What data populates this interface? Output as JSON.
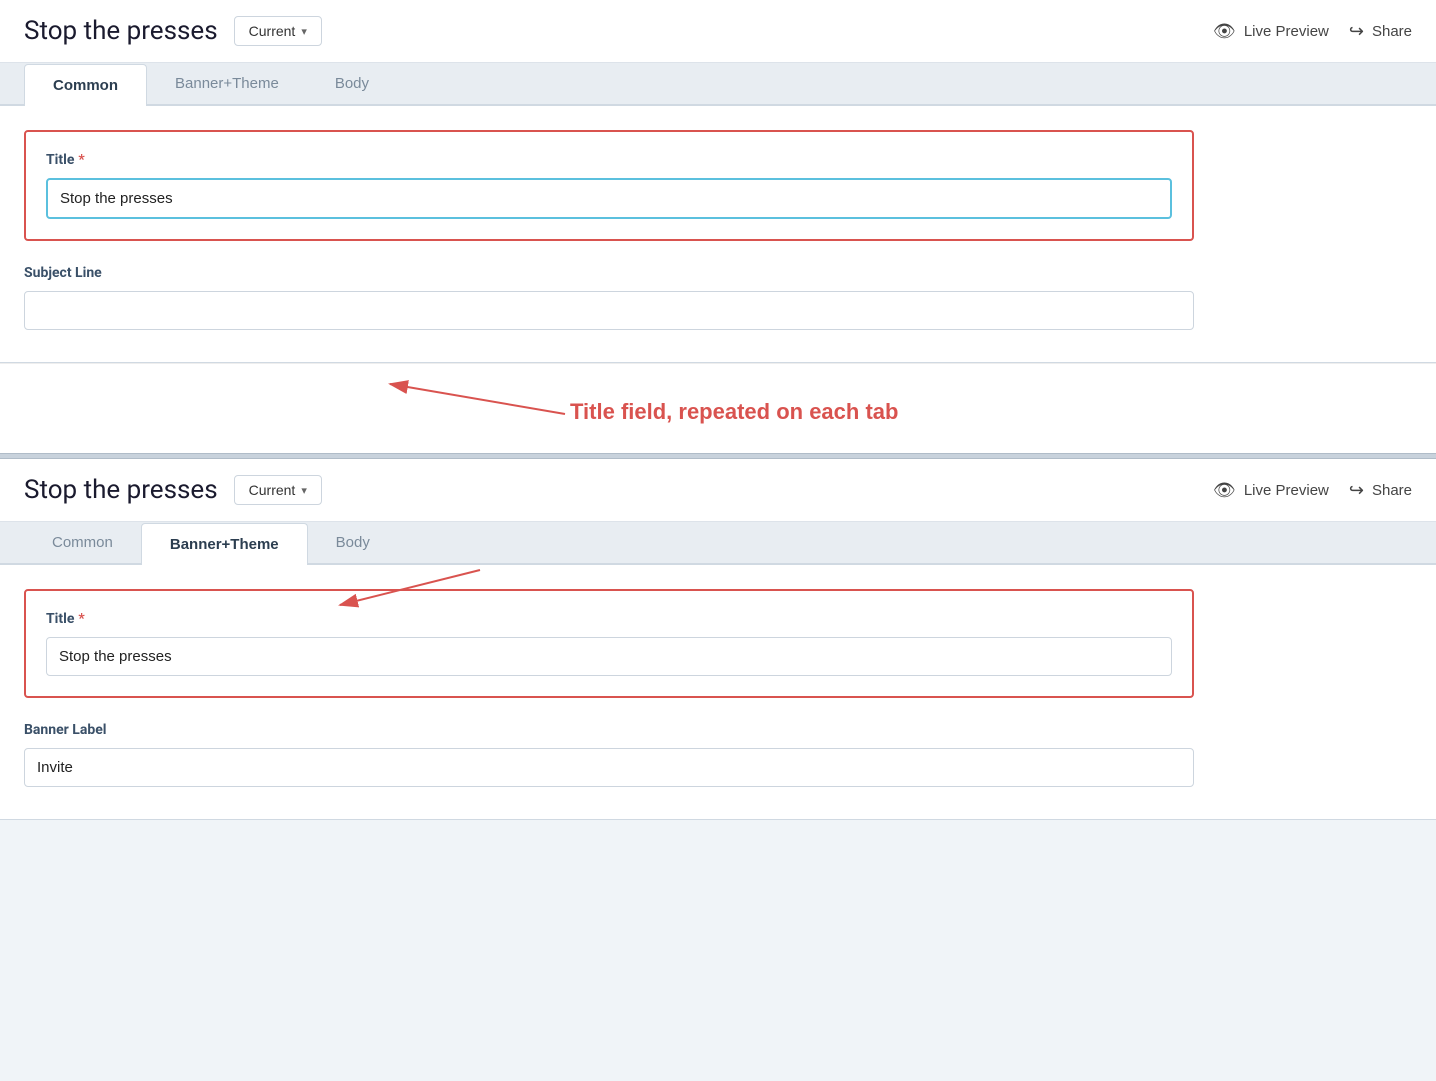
{
  "page": {
    "title": "Stop the presses"
  },
  "header": {
    "title": "Stop the presses",
    "version_label": "Current",
    "chevron": "∨",
    "live_preview_label": "Live Preview",
    "share_label": "Share"
  },
  "tabs_top": {
    "items": [
      {
        "id": "common",
        "label": "Common",
        "active": true
      },
      {
        "id": "banner_theme",
        "label": "Banner+Theme",
        "active": false
      },
      {
        "id": "body",
        "label": "Body",
        "active": false
      }
    ]
  },
  "form_top": {
    "title_label": "Title",
    "title_required": true,
    "title_value": "Stop the presses",
    "title_placeholder": "",
    "subject_line_label": "Subject Line",
    "subject_line_value": ""
  },
  "header2": {
    "title": "Stop the presses",
    "version_label": "Current",
    "chevron": "∨",
    "live_preview_label": "Live Preview",
    "share_label": "Share"
  },
  "tabs_bottom": {
    "items": [
      {
        "id": "common",
        "label": "Common",
        "active": false
      },
      {
        "id": "banner_theme",
        "label": "Banner+Theme",
        "active": true
      },
      {
        "id": "body",
        "label": "Body",
        "active": false
      }
    ]
  },
  "form_bottom": {
    "title_label": "Title",
    "title_required": true,
    "title_value": "Stop the presses",
    "banner_label": "Banner Label",
    "banner_value": "Invite"
  },
  "annotation": {
    "text": "Title field, repeated on each tab"
  }
}
